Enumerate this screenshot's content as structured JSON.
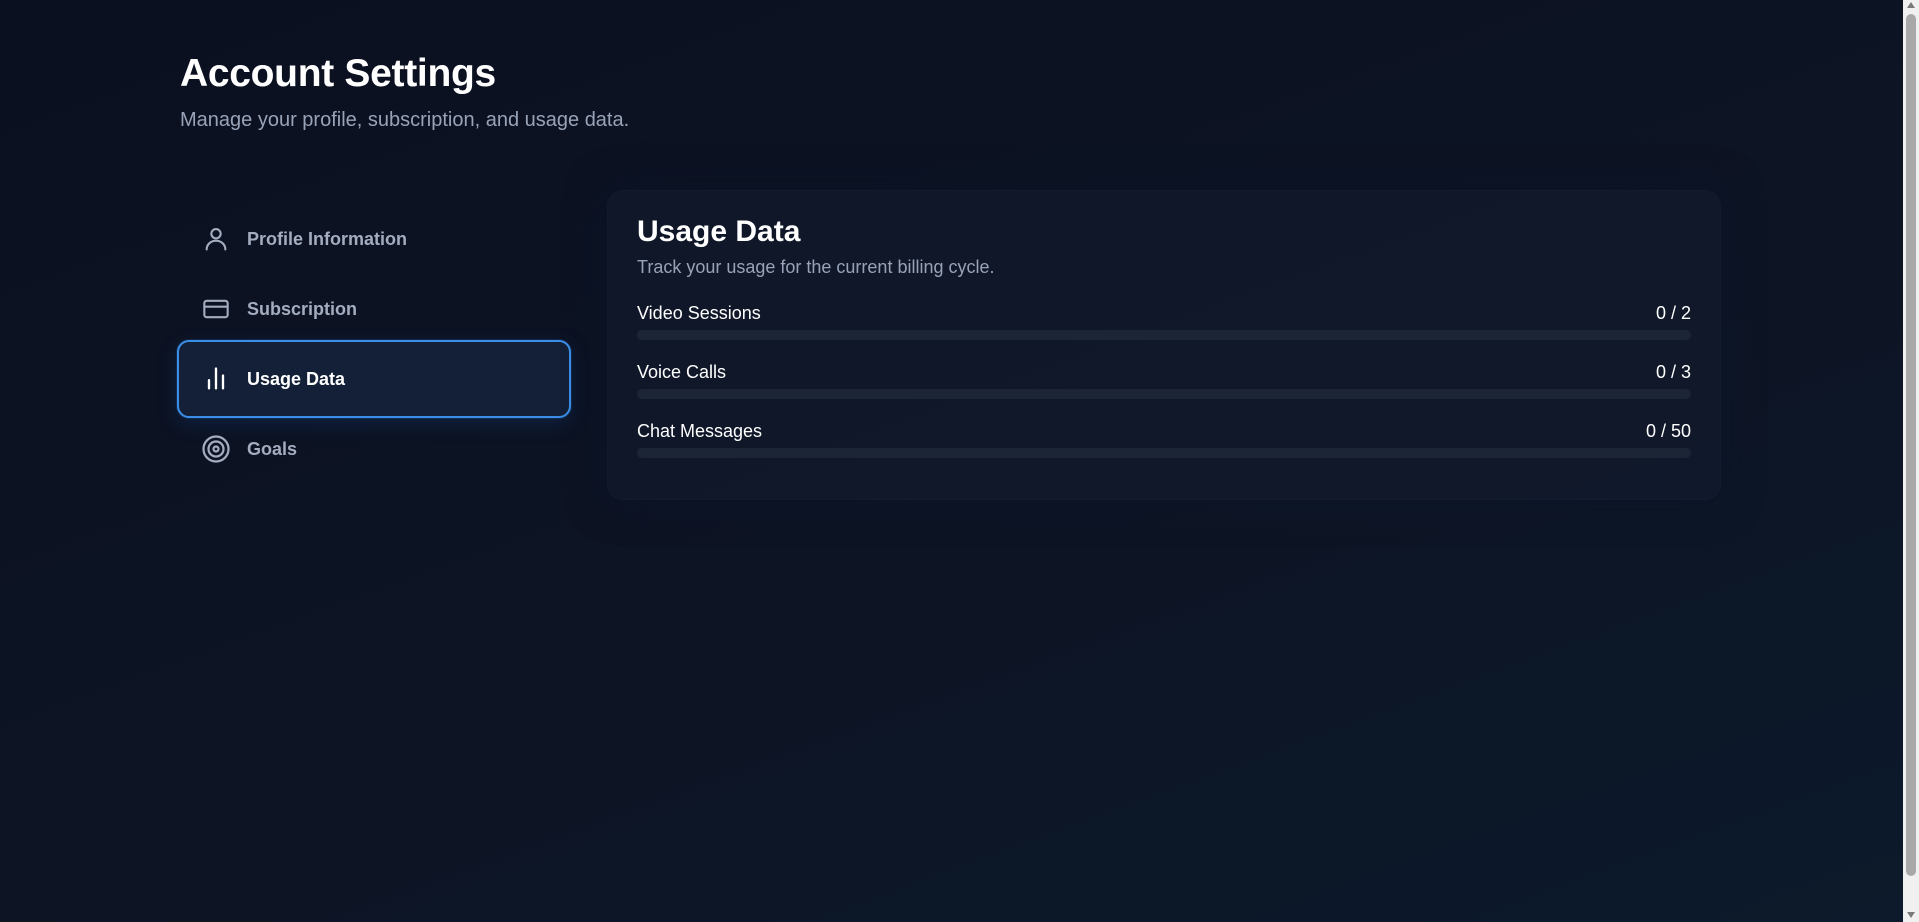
{
  "header": {
    "title": "Account Settings",
    "subtitle": "Manage your profile, subscription, and usage data."
  },
  "sidebar": {
    "items": [
      {
        "label": "Profile Information",
        "icon": "user-icon",
        "active": false
      },
      {
        "label": "Subscription",
        "icon": "credit-card-icon",
        "active": false
      },
      {
        "label": "Usage Data",
        "icon": "bar-chart-icon",
        "active": true
      },
      {
        "label": "Goals",
        "icon": "target-icon",
        "active": false
      }
    ]
  },
  "usage": {
    "title": "Usage Data",
    "subtitle": "Track your usage for the current billing cycle.",
    "items": [
      {
        "label": "Video Sessions",
        "value": "0 / 2",
        "progress": 0
      },
      {
        "label": "Voice Calls",
        "value": "0 / 3",
        "progress": 0
      },
      {
        "label": "Chat Messages",
        "value": "0 / 50",
        "progress": 0
      }
    ]
  },
  "colors": {
    "accent": "#3b8ee8",
    "background": "#0b1020",
    "muted_text": "#98a3b8",
    "track": "#1c2536"
  }
}
